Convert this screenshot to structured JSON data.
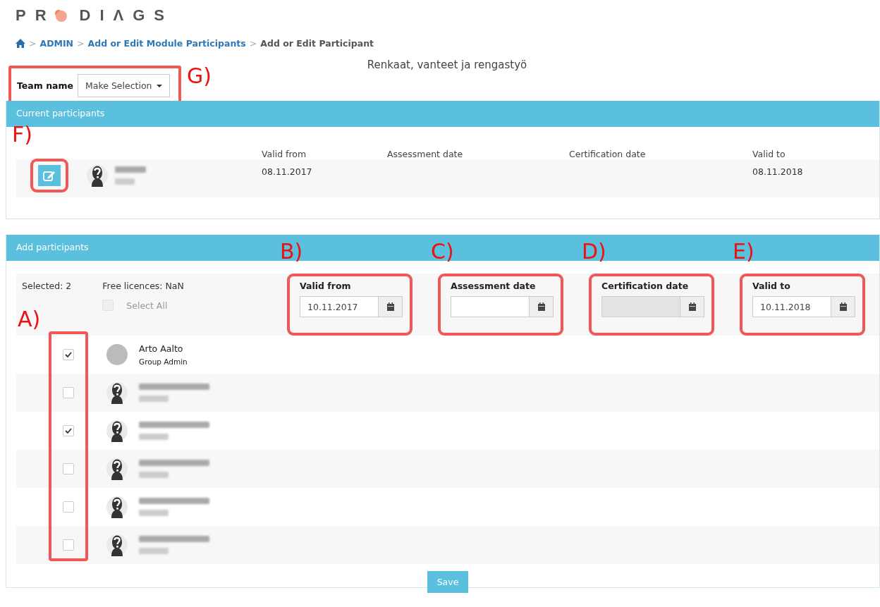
{
  "logo": {
    "before": "PR",
    "after": "DIΛGS"
  },
  "breadcrumb": {
    "separator": ">",
    "items": [
      {
        "label": "ADMIN",
        "link": true
      },
      {
        "label": "Add or Edit Module Participants",
        "link": true
      },
      {
        "label": "Add or Edit Participant",
        "link": false
      }
    ]
  },
  "module_title": "Renkaat, vanteet ja rengastyö",
  "team": {
    "label": "Team name",
    "selector": "Make Selection",
    "annotation": "G)"
  },
  "current_participants": {
    "title": "Current participants",
    "edit_annotation": "F)",
    "columns": [
      "Valid from",
      "Assessment date",
      "Certification date",
      "Valid to"
    ],
    "rows": [
      {
        "valid_from": "08.11.2017",
        "valid_to": "08.11.2018"
      }
    ]
  },
  "add_participants": {
    "title": "Add participants",
    "selected": "Selected: 2",
    "free_licences": "Free licences: NaN",
    "select_all": {
      "label": "Select All",
      "checked": false,
      "disabled": true
    },
    "checkbox_annotation": "A)",
    "date_fields": [
      {
        "label": "Valid from",
        "value": "10.11.2017",
        "disabled": false,
        "annotation": "B)"
      },
      {
        "label": "Assessment date",
        "disabled": false,
        "annotation": "C)"
      },
      {
        "label": "Certification date",
        "disabled": true,
        "annotation": "D)"
      },
      {
        "label": "Valid to",
        "value": "10.11.2018",
        "disabled": false,
        "annotation": "E)"
      }
    ],
    "participants": [
      {
        "kind": "photo",
        "name": "Arto Aalto",
        "role": "Group Admin",
        "checked": true
      },
      {
        "kind": "silhouette",
        "checked": false
      },
      {
        "kind": "silhouette",
        "checked": true
      },
      {
        "kind": "silhouette",
        "checked": false
      },
      {
        "kind": "silhouette",
        "checked": false
      },
      {
        "kind": "silhouette",
        "checked": false
      }
    ]
  },
  "save_button": "Save"
}
